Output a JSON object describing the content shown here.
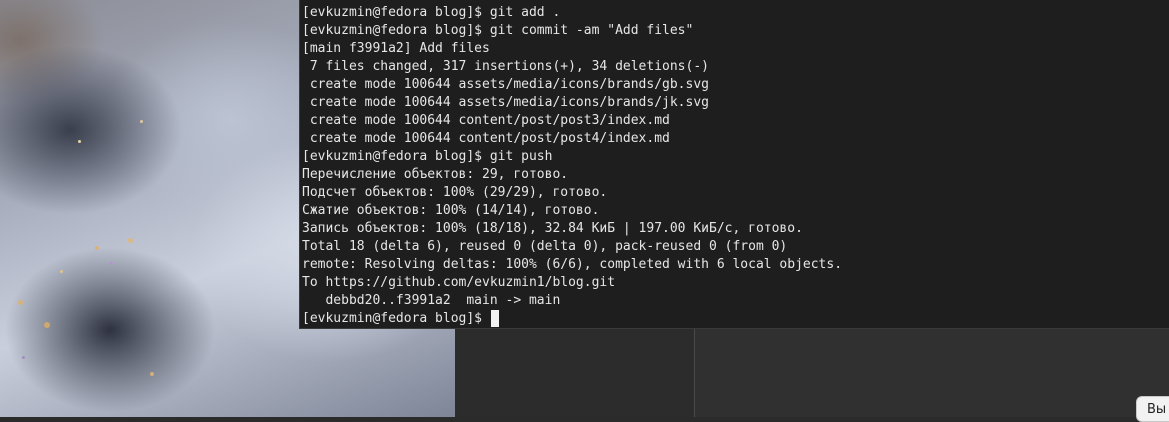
{
  "wallpaper": {
    "description_colors": [
      "#8b8c95",
      "#c9cfdc",
      "#2a2f3f"
    ]
  },
  "terminal": {
    "lines": [
      "[evkuzmin@fedora blog]$ git add .",
      "[evkuzmin@fedora blog]$ git commit -am \"Add files\"",
      "[main f3991a2] Add files",
      " 7 files changed, 317 insertions(+), 34 deletions(-)",
      " create mode 100644 assets/media/icons/brands/gb.svg",
      " create mode 100644 assets/media/icons/brands/jk.svg",
      " create mode 100644 content/post/post3/index.md",
      " create mode 100644 content/post/post4/index.md",
      "[evkuzmin@fedora blog]$ git push",
      "Перечисление объектов: 29, готово.",
      "Подсчет объектов: 100% (29/29), готово.",
      "Сжатие объектов: 100% (14/14), готово.",
      "Запись объектов: 100% (18/18), 32.84 КиБ | 197.00 КиБ/с, готово.",
      "Total 18 (delta 6), reused 0 (delta 0), pack-reused 0 (from 0)",
      "remote: Resolving deltas: 100% (6/6), completed with 6 local objects.",
      "To https://github.com/evkuzmin1/blog.git",
      "   debbd20..f3991a2  main -> main"
    ],
    "prompt": "[evkuzmin@fedora blog]$ ",
    "text_color": "#e6e6e6",
    "background_color": "#1e1e1e"
  },
  "corner_button": {
    "label": "Вы"
  }
}
